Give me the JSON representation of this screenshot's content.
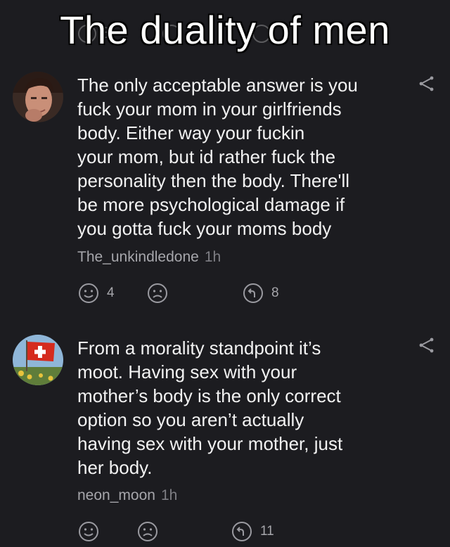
{
  "meme": {
    "title": "The duality of men"
  },
  "comments": [
    {
      "text_lines": [
        "The only acceptable answer is you",
        "fuck your mom in your girlfriends",
        "body. Either way your fuckin",
        "your mom, but id rather fuck the",
        "personality then the body. There'll",
        "be more psychological damage if",
        "you gotta fuck your moms body"
      ],
      "author": "The_unkindledone",
      "time": "1h",
      "likes": "4",
      "dislikes": "",
      "replies": "8",
      "avatar": "man-selfie-avatar"
    },
    {
      "text_lines": [
        "From a morality standpoint it’s",
        "moot. Having sex with your",
        "mother’s body is the only correct",
        "option so you aren’t actually",
        "having sex with your mother, just",
        "her body."
      ],
      "author": "neon_moon",
      "time": "1h",
      "likes": "",
      "dislikes": "",
      "replies": "11",
      "avatar": "swiss-flag-avatar"
    }
  ],
  "ghost_overlay": {
    "reply_count": "8"
  },
  "colors": {
    "background": "#1c1c20",
    "text": "#f2f2f2",
    "meta": "#a6a6ab",
    "icon": "#9a9aa0"
  }
}
